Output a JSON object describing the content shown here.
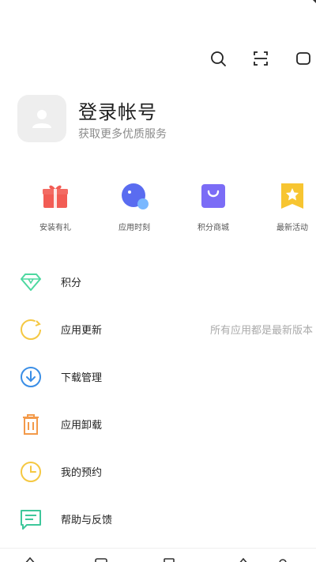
{
  "header": {
    "icons": [
      "search-icon",
      "scan-icon",
      "message-icon"
    ]
  },
  "profile": {
    "title": "登录帐号",
    "subtitle": "获取更多优质服务"
  },
  "quick_actions": [
    {
      "label": "安装有礼",
      "icon": "gift-icon",
      "color": "#f25c54"
    },
    {
      "label": "应用时刻",
      "icon": "moment-icon",
      "color": "#5a6cf0"
    },
    {
      "label": "积分商城",
      "icon": "shopping-bag-icon",
      "color": "#7b6cf6"
    },
    {
      "label": "最新活动",
      "icon": "star-flag-icon",
      "color": "#f7c531"
    }
  ],
  "menu": [
    {
      "label": "积分",
      "icon": "gem-icon",
      "color": "#4dd8a0",
      "right": ""
    },
    {
      "label": "应用更新",
      "icon": "refresh-icon",
      "color": "#f5c842",
      "right": "所有应用都是最新版本"
    },
    {
      "label": "下载管理",
      "icon": "download-icon",
      "color": "#3a8ee6",
      "right": ""
    },
    {
      "label": "应用卸载",
      "icon": "trash-icon",
      "color": "#f39a4a",
      "right": ""
    },
    {
      "label": "我的预约",
      "icon": "clock-icon",
      "color": "#f5c842",
      "right": ""
    },
    {
      "label": "帮助与反馈",
      "icon": "feedback-icon",
      "color": "#3ec79b",
      "right": ""
    }
  ]
}
